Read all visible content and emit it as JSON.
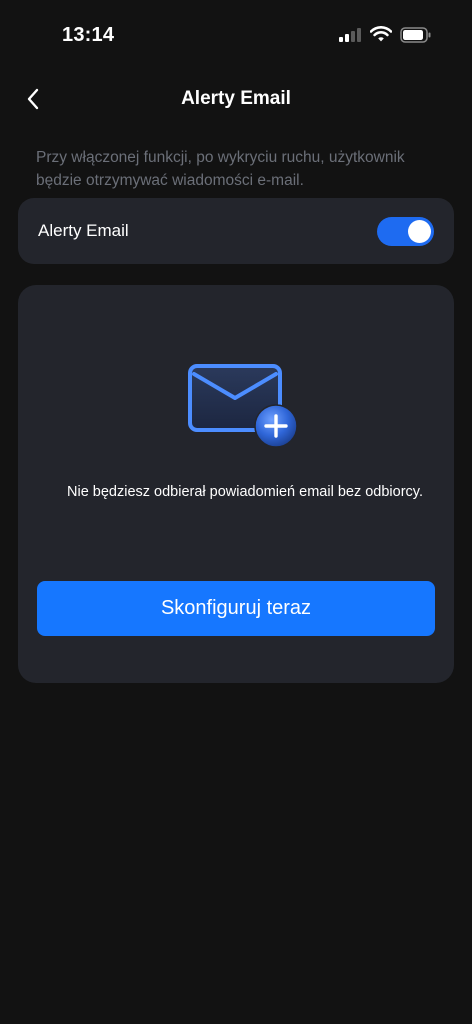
{
  "status_bar": {
    "time": "13:14",
    "signal_icon": "cellular-signal-icon",
    "wifi_icon": "wifi-icon",
    "battery_icon": "battery-icon"
  },
  "header": {
    "back_icon": "chevron-left-icon",
    "title": "Alerty Email"
  },
  "description": "Przy włączonej funkcji, po wykryciu ruchu, użytkownik będzie otrzymywać wiadomości e-mail.",
  "toggle_card": {
    "label": "Alerty Email",
    "enabled": true
  },
  "empty_state": {
    "icon": "envelope-add-icon",
    "message": "Nie będziesz odbierał powiadomień email bez odbiorcy.",
    "button_label": "Skonfiguruj teraz"
  },
  "colors": {
    "background": "#121212",
    "card": "#23252c",
    "accent": "#1677ff",
    "muted_text": "#6b6f78"
  }
}
